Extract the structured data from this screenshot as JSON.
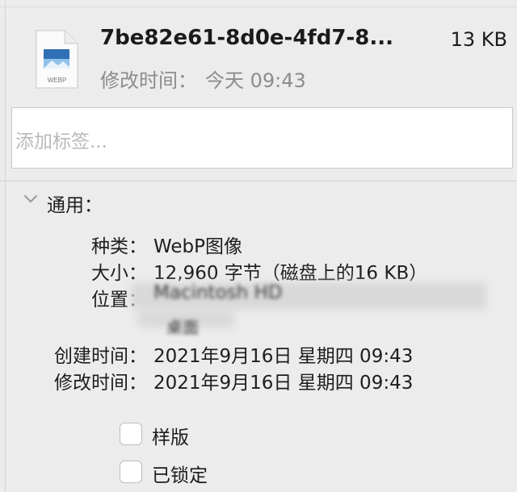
{
  "header": {
    "file_name": "7be82e61-8d0e-4fd7-8...",
    "file_size": "13 KB",
    "modified_label": "修改时间：",
    "modified_value": "今天 09:43",
    "icon_caption": "WEBP"
  },
  "tags": {
    "placeholder": "添加标签..."
  },
  "general": {
    "title": "通用：",
    "kind_label": "种类：",
    "kind_value": "WebP图像",
    "size_label": "大小：",
    "size_value": "12,960 字节（磁盘上的16 KB）",
    "where_label": "位置：",
    "where_value_blurred": "Macintosh HD",
    "where_value_blurred_line2": "桌面",
    "created_label": "创建时间：",
    "created_value": "2021年9月16日 星期四 09:43",
    "modified_label": "修改时间：",
    "modified_value": "2021年9月16日 星期四 09:43"
  },
  "checkboxes": {
    "stationery_label": "样版",
    "locked_label": "已锁定"
  },
  "colors": {
    "background": "#ececec",
    "secondary_text": "#8c8c8c",
    "placeholder_text": "#b9b9b9"
  },
  "icons": {
    "file_icon": "webp-file-icon",
    "disclosure": "chevron-down-icon"
  }
}
